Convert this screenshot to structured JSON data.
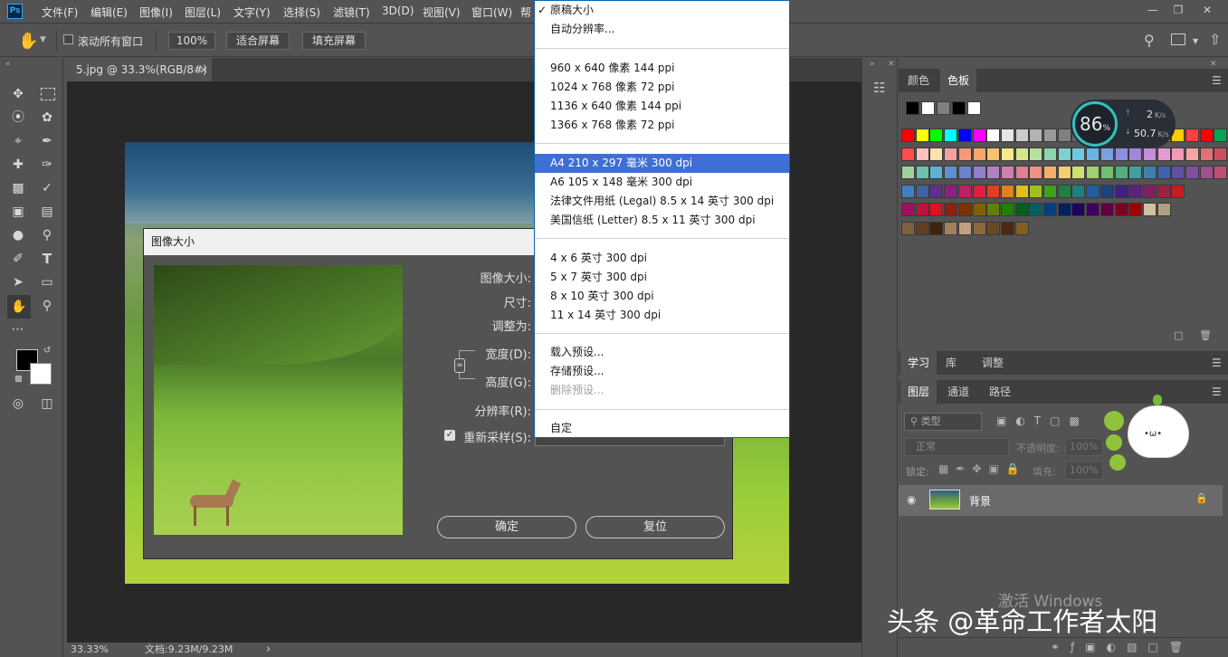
{
  "app": {
    "logo": "Ps"
  },
  "menubar": {
    "items": [
      "文件(F)",
      "编辑(E)",
      "图像(I)",
      "图层(L)",
      "文字(Y)",
      "选择(S)",
      "滤镜(T)",
      "3D(D)",
      "视图(V)",
      "窗口(W)",
      "帮"
    ]
  },
  "optionsbar": {
    "scroll_all_label": "滚动所有窗口",
    "zoom": "100%",
    "fit_screen": "适合屏幕",
    "fill_screen": "填充屏幕"
  },
  "document": {
    "tab_title": "5.jpg @ 33.3%(RGB/8#)",
    "tab_close": "×",
    "zoom": "33.33%",
    "doc_info": "文档:9.23M/9.23M",
    "arrow": "›"
  },
  "dialog": {
    "title": "图像大小",
    "image_size_label": "图像大小:",
    "dimensions_label": "尺寸:",
    "fit_to_label": "调整为:",
    "width_label": "宽度(D):",
    "height_label": "高度(G):",
    "resolution_label": "分辨率(R):",
    "resample_label": "重新采样(S):",
    "ok": "确定",
    "reset": "复位"
  },
  "dropdown": {
    "groups": [
      [
        "原稿大小",
        "自动分辨率..."
      ],
      [
        "960 x 640 像素 144 ppi",
        "1024 x 768 像素 72 ppi",
        "1136 x 640 像素 144 ppi",
        "1366 x 768 像素 72 ppi"
      ],
      [
        "A4 210 x 297 毫米 300 dpi",
        "A6 105 x 148 毫米 300 dpi",
        "法律文件用纸 (Legal) 8.5 x 14 英寸 300 dpi",
        "美国信纸 (Letter) 8.5 x 11 英寸 300 dpi"
      ],
      [
        "4 x 6 英寸 300 dpi",
        "5 x 7 英寸 300 dpi",
        "8 x 10 英寸 300 dpi",
        "11 x 14 英寸 300 dpi"
      ],
      [
        "载入预设...",
        "存储预设...",
        "删除预设..."
      ],
      [
        "自定"
      ]
    ],
    "checked": "原稿大小",
    "selected": "A4 210 x 297 毫米 300 dpi",
    "disabled": "删除预设..."
  },
  "panels": {
    "color_tabs": [
      "颜色",
      "色板"
    ],
    "learn_tabs": [
      "学习",
      "库",
      "调整"
    ],
    "layer_tabs": [
      "图层",
      "通道",
      "路径"
    ],
    "filter_kind": "类型",
    "blend_mode": "正常",
    "opacity_label": "不透明度:",
    "opacity_value": "100%",
    "lock_label": "锁定:",
    "fill_label": "填充:",
    "fill_value": "100%",
    "layer_name": "背景"
  },
  "speed_widget": {
    "percent": "86",
    "percent_sign": "%",
    "up": "2",
    "up_unit": "K/s",
    "down": "50.7",
    "down_unit": "K/s"
  },
  "watermarks": {
    "activate_windows": "激活 Windows",
    "toutiao": "头条 @革命工作者太阳"
  },
  "colors": {
    "accent_blue": "#31a8ff",
    "dropdown_selected": "#3d6fd6"
  },
  "swatches": {
    "top_row": [
      "#000000",
      "#ffffff",
      "#808080",
      "#000000",
      "#ffffff"
    ],
    "rows": [
      [
        "#ff0000",
        "#ffff00",
        "#00ff00",
        "#00ffff",
        "#0000ff",
        "#ff00ff",
        "#ffffff",
        "#e6e6e6",
        "#cccccc",
        "#b3b3b3",
        "#999999",
        "#808080",
        "#666666",
        "#4d4d4d",
        "#333333",
        "#1a1a1a",
        "#000000",
        "#ff0000",
        "#ff8080",
        "#ffcc00",
        "#ff4040",
        "#ff0000",
        "#00a651"
      ],
      [
        "#ff4d4d",
        "#ffc0c0",
        "#ffe0b0",
        "#f5a0a0",
        "#f59a7a",
        "#f7a66e",
        "#f7c36e",
        "#f9e88b",
        "#d2e88b",
        "#b9e0a0",
        "#8ed4b0",
        "#7ecfd0",
        "#70c8e0",
        "#6bb4e8",
        "#7aa0e0",
        "#8f8ddc",
        "#a387d6",
        "#c38fd6",
        "#e39ad0",
        "#f09ab8",
        "#f5a3a3",
        "#e0707a",
        "#c85060"
      ],
      [
        "#a0d0a0",
        "#70c0b0",
        "#60b0d0",
        "#6090d0",
        "#7080d0",
        "#9080c8",
        "#b080c0",
        "#d080b0",
        "#e08090",
        "#f09080",
        "#f0b070",
        "#f0d070",
        "#d0e070",
        "#a0d070",
        "#70c070",
        "#50b080",
        "#40a0a0",
        "#4080b0",
        "#4060b0",
        "#6050a0",
        "#8050a0",
        "#a05090",
        "#c05070"
      ],
      [
        "#4080c0",
        "#4060a0",
        "#603090",
        "#902080",
        "#c02060",
        "#e02040",
        "#e04020",
        "#e08020",
        "#e0c020",
        "#a0c020",
        "#40a020",
        "#208040",
        "#208080",
        "#2060a0",
        "#204080",
        "#402080",
        "#602080",
        "#802060",
        "#a02040",
        "#c02020"
      ],
      [
        "#a01060",
        "#c01040",
        "#e01020",
        "#902010",
        "#803000",
        "#806000",
        "#608000",
        "#208000",
        "#006020",
        "#006060",
        "#004080",
        "#002060",
        "#200060",
        "#400060",
        "#600040",
        "#800020",
        "#a00000",
        "#d0c0a0",
        "#b0a080"
      ],
      [
        "#806040",
        "#604020",
        "#402010",
        "#a08060",
        "#c0a080",
        "#8a6a40",
        "#6a4a20",
        "#4a2a10",
        "#806020"
      ]
    ]
  }
}
